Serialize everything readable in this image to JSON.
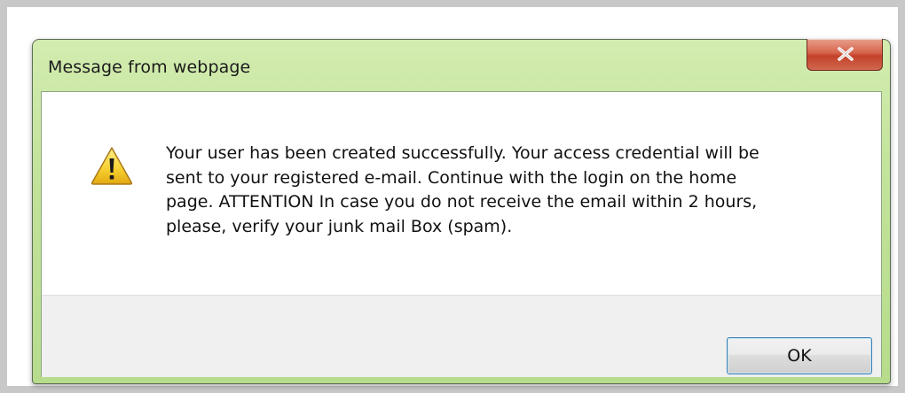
{
  "dialog": {
    "title": "Message from webpage",
    "message": "Your user has been created successfully. Your access credential will be\nsent to your registered e-mail. Continue with the login on the home\npage. ATTENTION In case you do not receive the email within 2 hours,\nplease, verify your junk mail Box (spam).",
    "ok_label": "OK",
    "icon": "warning-icon",
    "close_icon": "close-icon"
  },
  "colors": {
    "titlebar": "#c2e39a",
    "close_button": "#c4412a",
    "ok_border": "#3c7fb1",
    "footer": "#f0f0f0"
  }
}
